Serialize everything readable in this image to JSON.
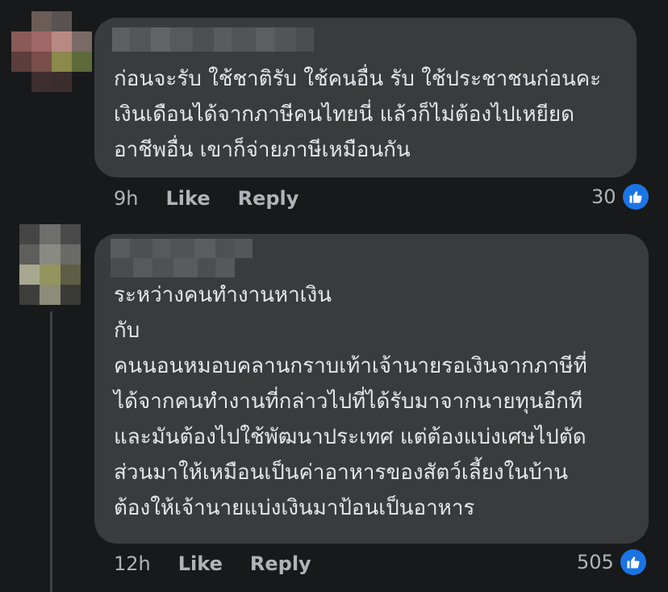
{
  "comments": [
    {
      "lines": [
        "ก่อนจะรับ ใช้ชาติรับ ใช้คนอื่น รับ ใช้ประชาชนก่อนคะ",
        "เงินเดือนได้จากภาษีคนไทยนี่ แล้วก็ไม่ต้องไปเหยียด",
        "อาชีพอื่น เขาก็จ่ายภาษีเหมือนกัน"
      ],
      "time": "9h",
      "like_label": "Like",
      "reply_label": "Reply",
      "like_count": "30"
    },
    {
      "lines": [
        "ระหว่างคนทำงานหาเงิน",
        "กับ",
        "คนนอนหมอบคลานกราบเท้าเจ้านายรอเงินจากภาษีที่",
        "ได้จากคนทำงานที่กล่าวไปที่ได้รับมาจากนายทุนอีกที",
        "และมันต้องไปใช้พัฒนาประเทศ แต่ต้องแบ่งเศษไปตัด",
        "ส่วนมาให้เหมือนเป็นค่าอาหารของสัตว์เลี้ยงในบ้าน",
        "ต้องให้เจ้านายแบ่งเงินมาป้อนเป็นอาหาร"
      ],
      "time": "12h",
      "like_label": "Like",
      "reply_label": "Reply",
      "like_count": "505"
    }
  ],
  "colors": {
    "background": "#18191a",
    "bubble": "#3a3b3c",
    "text": "#e4e6eb",
    "secondary": "#b0b3b8",
    "like_blue": "#1b74e4"
  },
  "icons": [
    "thumbs-up-icon"
  ]
}
